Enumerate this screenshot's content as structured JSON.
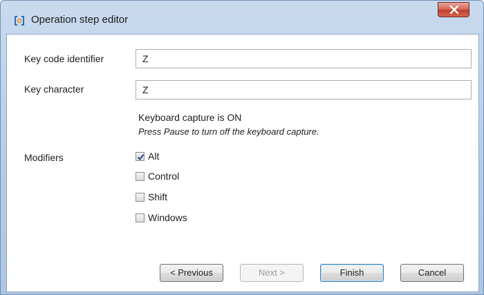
{
  "window": {
    "title": "Operation step editor",
    "accent": "#3c7fb1",
    "close_color": "#c1412f"
  },
  "form": {
    "key_code_label": "Key code identifier",
    "key_code_value": "Z",
    "key_char_label": "Key character",
    "key_char_value": "Z",
    "capture_status": "Keyboard capture is ON",
    "capture_hint": "Press Pause to turn off the keyboard capture.",
    "modifiers_label": "Modifiers",
    "modifiers": [
      {
        "label": "Alt",
        "checked": true
      },
      {
        "label": "Control",
        "checked": false
      },
      {
        "label": "Shift",
        "checked": false
      },
      {
        "label": "Windows",
        "checked": false
      }
    ]
  },
  "buttons": {
    "previous": "< Previous",
    "next": "Next >",
    "finish": "Finish",
    "cancel": "Cancel"
  },
  "icons": {
    "app": "operation-editor-icon",
    "close": "close-icon",
    "check": "checkmark-icon"
  }
}
